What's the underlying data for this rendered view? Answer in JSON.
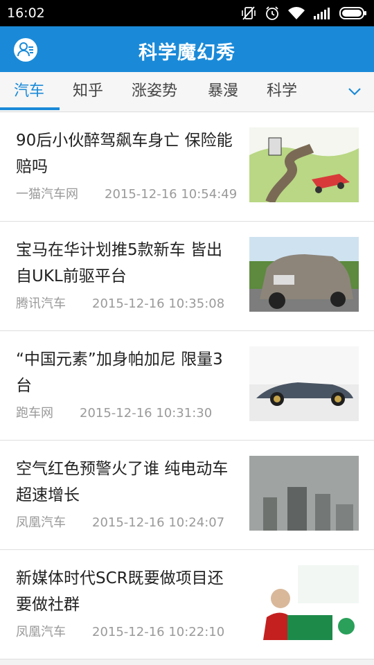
{
  "status_bar": {
    "time": "16:02",
    "icons": [
      "mute-vibrate-icon",
      "alarm-icon",
      "wifi-icon",
      "signal-icon",
      "battery-icon"
    ]
  },
  "app_bar": {
    "title": "科学魔幻秀",
    "accent_color": "#1a8ad8"
  },
  "tabs": {
    "items": [
      "汽车",
      "知乎",
      "涨姿势",
      "暴漫",
      "科学"
    ],
    "selected": "汽车",
    "expand_icon": "chevron-down-icon"
  },
  "articles": [
    {
      "title": "90后小伙醉驾飙车身亡 保险能赔吗",
      "source": "一猫汽车网",
      "time": "2015-12-16 10:54:49"
    },
    {
      "title": "宝马在华计划推5款新车 皆出自UKL前驱平台",
      "source": "腾讯汽车",
      "time": "2015-12-16 10:35:08"
    },
    {
      "title": "“中国元素”加身帕加尼 限量3台",
      "source": "跑车网",
      "time": "2015-12-16 10:31:30"
    },
    {
      "title": "空气红色预警火了谁 纯电动车超速增长",
      "source": "凤凰汽车",
      "time": "2015-12-16 10:24:07"
    },
    {
      "title": "新媒体时代SCR既要做项目还要做社群",
      "source": "凤凰汽车",
      "time": "2015-12-16 10:22:10"
    }
  ]
}
